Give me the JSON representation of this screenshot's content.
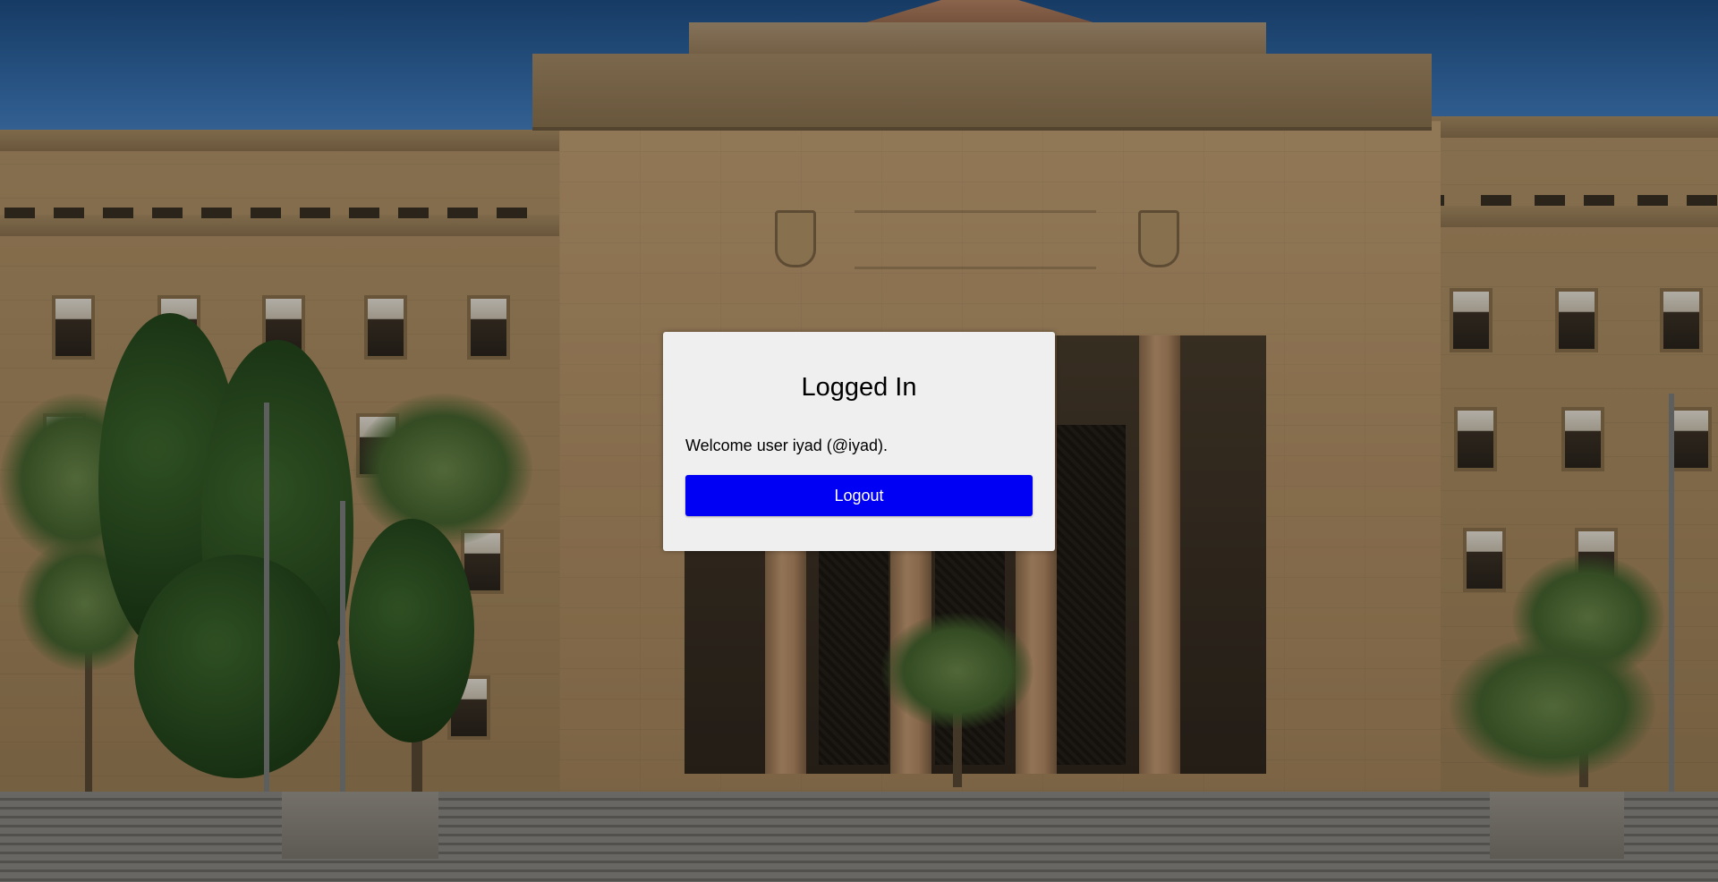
{
  "card": {
    "title": "Logged In",
    "welcome_message": "Welcome user iyad (@iyad).",
    "logout_label": "Logout"
  },
  "colors": {
    "card_background": "#efefef",
    "logout_button": "#0000f5",
    "logout_text": "#ffffff"
  },
  "background": {
    "description_icon": "building-photo"
  }
}
